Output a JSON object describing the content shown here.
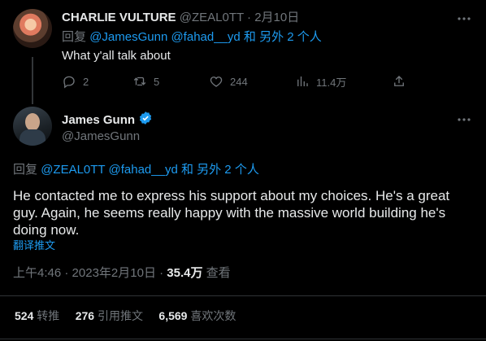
{
  "reply_tweet": {
    "author_name": "CHARLIE VULTURE",
    "author_handle": "@ZEAL0TT",
    "date": "2月10日",
    "reply_prefix": "回复",
    "reply_mentions": "@JamesGunn @fahad__yd",
    "reply_suffix": "和 另外 2 个人",
    "text": "What y'all talk about",
    "actions": {
      "replies": "2",
      "retweets": "5",
      "likes": "244",
      "views": "11.4万"
    }
  },
  "main_tweet": {
    "author_name": "James Gunn",
    "author_handle": "@JamesGunn",
    "reply_prefix": "回复",
    "reply_mentions": "@ZEAL0TT @fahad__yd",
    "reply_suffix": "和 另外 2 个人",
    "text": "He contacted me to express his support about my choices. He's a great guy. Again, he seems really happy with the massive world building he's doing now.",
    "translate_link": "翻译推文",
    "time": "上午4:46",
    "separator": "·",
    "date": "2023年2月10日",
    "views_count": "35.4万",
    "views_label": "查看",
    "stats": {
      "retweets_count": "524",
      "retweets_label": "转推",
      "quotes_count": "276",
      "quotes_label": "引用推文",
      "likes_count": "6,569",
      "likes_label": "喜欢次数"
    }
  },
  "colors": {
    "background": "#000000",
    "text": "#e7e9ea",
    "muted": "#71767b",
    "link": "#1d9bf0",
    "divider": "#2f3336"
  },
  "icons": [
    "more-icon",
    "reply-icon",
    "retweet-icon",
    "like-icon",
    "views-icon",
    "share-icon",
    "verified-badge-icon"
  ]
}
